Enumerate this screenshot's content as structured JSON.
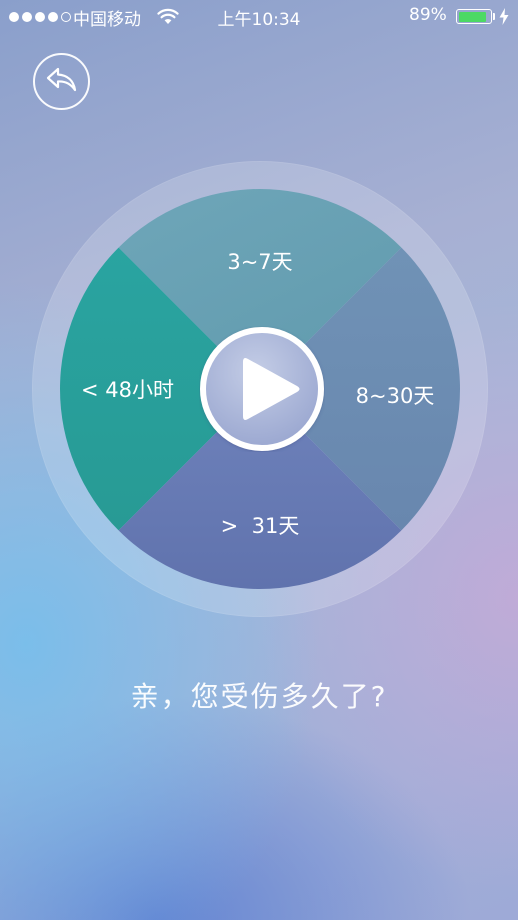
{
  "status_bar": {
    "carrier": "中国移动",
    "time": "上午10:34",
    "battery_percent": "89%",
    "battery_level": 0.89,
    "signal_strength": 4,
    "signal_max": 5,
    "icons": [
      "wifi-icon",
      "battery-icon",
      "charging-bolt-icon"
    ]
  },
  "nav": {
    "back_icon": "back-arrow-icon"
  },
  "wheel": {
    "segments": [
      {
        "id": "top",
        "label": "3~7天",
        "color": "#6aa3b8"
      },
      {
        "id": "left",
        "label": "< 48小时",
        "color": "#2a9f9e"
      },
      {
        "id": "right",
        "label": "8~30天",
        "color": "#6c90b4"
      },
      {
        "id": "bottom",
        "label": ">  31天",
        "color": "#6678b2"
      }
    ],
    "play_icon": "play-icon"
  },
  "prompt": {
    "question": "亲，您受伤多久了?"
  },
  "colors": {
    "accent_teal": "#2a9f9e",
    "battery_green": "#4cd964"
  }
}
